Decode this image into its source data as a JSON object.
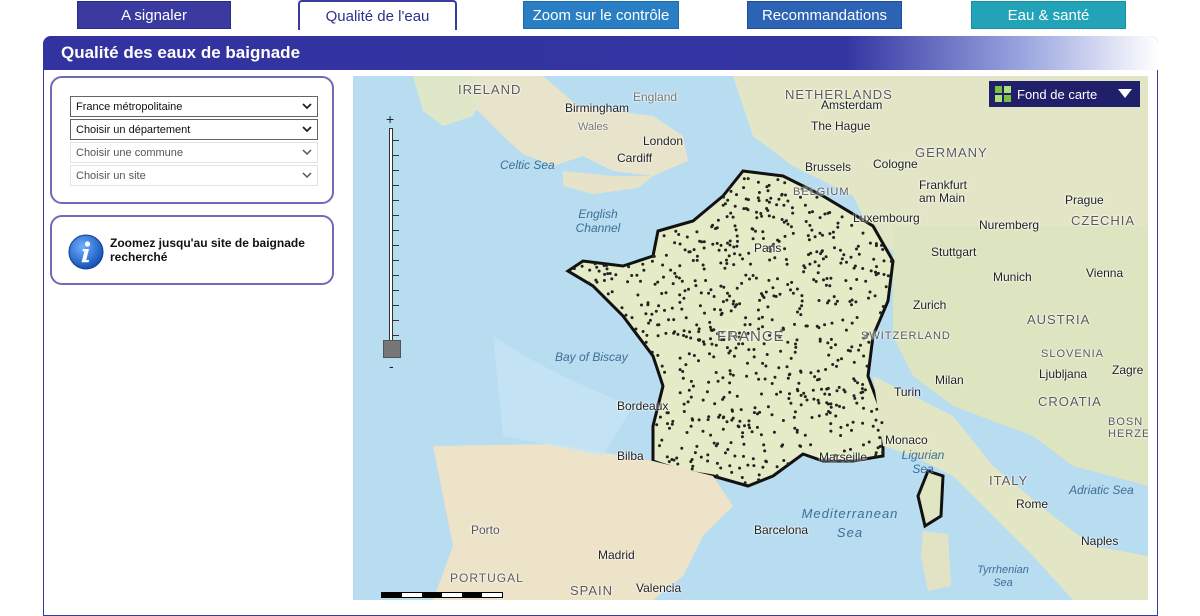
{
  "tabs": [
    {
      "label": "A signaler",
      "active": false
    },
    {
      "label": "Qualité de l'eau",
      "active": true
    },
    {
      "label": "Zoom sur le contrôle",
      "active": false
    },
    {
      "label": "Recommandations",
      "active": false
    },
    {
      "label": "Eau & santé",
      "active": false
    }
  ],
  "page_title": "Qualité des eaux de baignade",
  "selects": [
    {
      "value": "France métropolitaine",
      "enabled": true
    },
    {
      "value": "Choisir un département",
      "enabled": true
    },
    {
      "value": "Choisir une commune",
      "enabled": false
    },
    {
      "value": "Choisir un site",
      "enabled": false
    }
  ],
  "info": {
    "text": "Zoomez jusqu'au site de baignade recherché",
    "icon": "info-icon"
  },
  "map": {
    "basemap_button": "Fond de carte",
    "zoom_in": "+",
    "zoom_out": "-",
    "labels": {
      "ireland": "IRELAND",
      "england": "England",
      "wales": "Wales",
      "birmingham": "Birmingham",
      "london": "London",
      "cardiff": "Cardiff",
      "celtic_sea": "Celtic Sea",
      "english_channel": "English Channel",
      "netherlands": "NETHERLANDS",
      "amsterdam": "Amsterdam",
      "the_hague": "The Hague",
      "brussels": "Brussels",
      "belgium": "BELGIUM",
      "cologne": "Cologne",
      "germany": "GERMANY",
      "frankfurt": "Frankfurt am Main",
      "luxembourg": "Luxembourg",
      "nuremberg": "Nuremberg",
      "prague": "Prague",
      "czechia": "CZECHIA",
      "stuttgart": "Stuttgart",
      "munich": "Munich",
      "vienna": "Vienna",
      "paris": "Paris",
      "zurich": "Zurich",
      "austria": "AUSTRIA",
      "switzerland": "SWITZERLAND",
      "france": "FRANCE",
      "bay_of_biscay": "Bay of Biscay",
      "slovenia": "SLOVENIA",
      "ljubljana": "Ljubljana",
      "zagreb": "Zagre",
      "milan": "Milan",
      "turin": "Turin",
      "croatia": "CROATIA",
      "bosnia": "BOSN HERZE",
      "bordeaux": "Bordeaux",
      "monaco": "Monaco",
      "ligurian_sea": "Ligurian Sea",
      "bilbao": "Bilba",
      "marseille": "Marseille",
      "italy": "ITALY",
      "adriatic_sea": "Adriatic Sea",
      "rome": "Rome",
      "mediterranean_sea": "Mediterranean Sea",
      "barcelona": "Barcelona",
      "porto": "Porto",
      "madrid": "Madrid",
      "naples": "Naples",
      "portugal": "PORTUGAL",
      "spain": "SPAIN",
      "valencia": "Valencia",
      "tyrrhenian_sea": "Tyrrhenian Sea"
    }
  },
  "colors": {
    "primary": "#3535a2",
    "tab_zoom": "#2a7fc4",
    "tab_reco": "#2d63b4",
    "tab_sante": "#23a3b8",
    "panel_border": "#6e6ab6",
    "site_marker": "#222222"
  }
}
